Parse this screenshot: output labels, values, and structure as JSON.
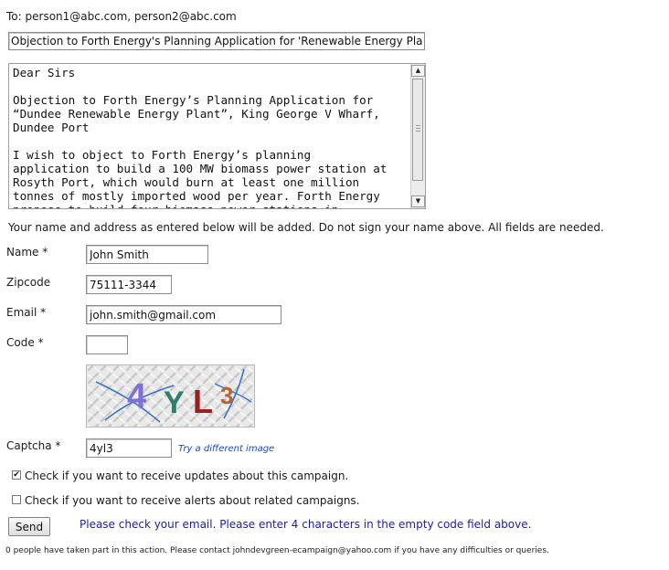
{
  "to": {
    "label": "To:",
    "recipients": "person1@abc.com, person2@abc.com"
  },
  "subject": "Objection to Forth Energy's Planning Application for 'Renewable Energy Plant'",
  "message": "Dear Sirs\n\nObjection to Forth Energy’s Planning Application for\n“Dundee Renewable Energy Plant”, King George V Wharf,\nDundee Port\n\nI wish to object to Forth Energy’s planning\napplication to build a 100 MW biomass power station at\nRosyth Port, which would burn at least one million\ntonnes of mostly imported wood per year. Forth Energy\npropose to build four biomass power stations in",
  "notice": "Your name and address as entered below will be added. Do not sign your name above. All fields are needed.",
  "form": {
    "name_label": "Name *",
    "name_value": "John Smith",
    "zip_label": "Zipcode",
    "zip_value": "75111-3344",
    "email_label": "Email *",
    "email_value": "john.smith@gmail.com",
    "code_label": "Code *",
    "code_value": "",
    "captcha_label": "Captcha *",
    "captcha_value": "4yl3",
    "captcha_text": "4YL3",
    "try_link": "Try a different image"
  },
  "checkboxes": [
    {
      "label": "Check if you want to receive updates about this campaign.",
      "checked": true
    },
    {
      "label": "Check if you want to receive alerts about related campaigns.",
      "checked": false
    }
  ],
  "send_label": "Send",
  "status_message": "Please check your email. Please enter 4 characters in the empty code field above.",
  "footer": "0 people have taken part in this action. Please contact johndevgreen-ecampaign@yahoo.com if you have any difficulties or queries.",
  "colors": {
    "link": "#1a49c8",
    "status": "#1b1bb0"
  },
  "icons": {
    "scroll_up": "triangle-up",
    "scroll_down": "triangle-down",
    "checkmark": "check"
  }
}
